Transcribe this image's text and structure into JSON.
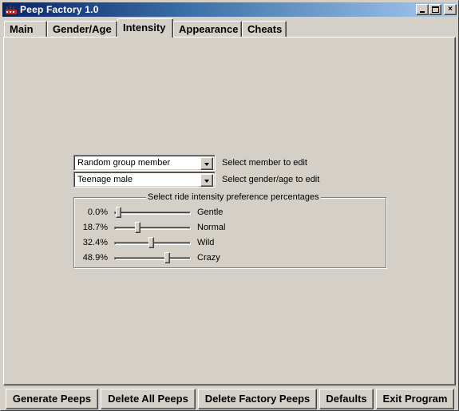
{
  "window": {
    "title": "Peep Factory 1.0",
    "icon": "factory-icon",
    "controls": {
      "minimize": "minimize-icon",
      "maximize": "maximize-icon",
      "close": "×"
    }
  },
  "tabs": [
    {
      "label": "Main",
      "active": false
    },
    {
      "label": "Gender/Age",
      "active": false
    },
    {
      "label": "Intensity",
      "active": true
    },
    {
      "label": "Appearance",
      "active": false
    },
    {
      "label": "Cheats",
      "active": false
    }
  ],
  "intensity": {
    "member_select": {
      "value": "Random group member",
      "label": "Select member to edit"
    },
    "gender_select": {
      "value": "Teenage male",
      "label": "Select gender/age to edit"
    },
    "group_title": "Select ride intensity preference percentages",
    "sliders": [
      {
        "name": "Gentle",
        "percent_text": "0.0%",
        "value": 0.0
      },
      {
        "name": "Normal",
        "percent_text": "18.7%",
        "value": 18.7
      },
      {
        "name": "Wild",
        "percent_text": "32.4%",
        "value": 32.4
      },
      {
        "name": "Crazy",
        "percent_text": "48.9%",
        "value": 48.9
      }
    ]
  },
  "buttons": {
    "generate": "Generate Peeps",
    "delete_all": "Delete All Peeps",
    "delete_factory": "Delete Factory Peeps",
    "defaults": "Defaults",
    "exit": "Exit Program"
  }
}
